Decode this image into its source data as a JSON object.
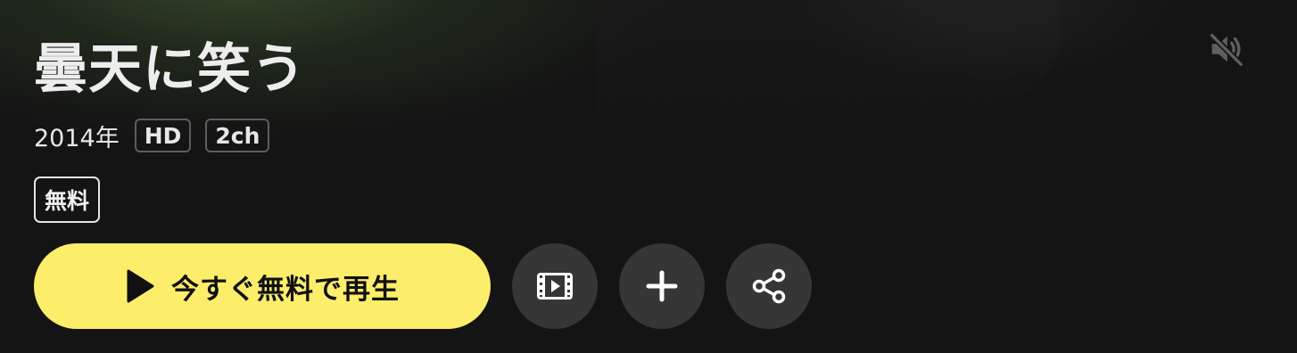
{
  "title": "曇天に笑う",
  "meta": {
    "year": "2014年",
    "tags": [
      "HD",
      "2ch"
    ]
  },
  "badge": {
    "free": "無料"
  },
  "actions": {
    "play_label": "今すぐ無料で再生",
    "play_icon": "play-icon",
    "trailer_icon": "film-play-icon",
    "add_icon": "plus-icon",
    "share_icon": "share-icon"
  },
  "controls": {
    "mute_icon": "speaker-muted-icon"
  },
  "colors": {
    "background": "#141414",
    "accent": "#fcee6a",
    "circle_button": "#363636",
    "title_text": "#ededed"
  }
}
